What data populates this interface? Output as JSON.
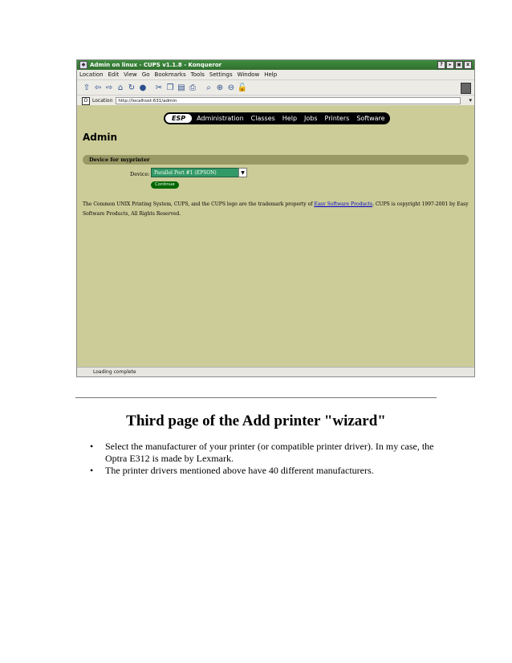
{
  "browser": {
    "title": "Admin on linux - CUPS v1.1.8 - Konqueror",
    "title_buttons": [
      "?",
      "▸",
      "▣",
      "x"
    ],
    "menu": [
      "Location",
      "Edit",
      "View",
      "Go",
      "Bookmarks",
      "Tools",
      "Settings",
      "Window",
      "Help"
    ],
    "location_label": "Location",
    "url": "http://localhost:631/admin",
    "status": "Loading complete"
  },
  "cups": {
    "nav": [
      "ESP",
      "Administration",
      "Classes",
      "Help",
      "Jobs",
      "Printers",
      "Software"
    ],
    "page_title": "Admin",
    "section_title": "Device for myprinter",
    "device_label": "Device:",
    "device_value": "Parallel Port #1 (EPSON)",
    "continue_label": "Continue",
    "footer_before": "The Common UNIX Printing System, CUPS, and the CUPS logo are the trademark property of ",
    "footer_link": "Easy Software Products",
    "footer_after": ". CUPS is copyright 1997-2001 by Easy Software Products, All Rights Reserved."
  },
  "document": {
    "heading": "Third page of the Add printer \"wizard\"",
    "bullets": [
      "Select the manufacturer of your printer (or compatible printer driver). In my case, the Optra E312 is made by Lexmark.",
      "The printer drivers mentioned above have 40 different manufacturers."
    ]
  }
}
